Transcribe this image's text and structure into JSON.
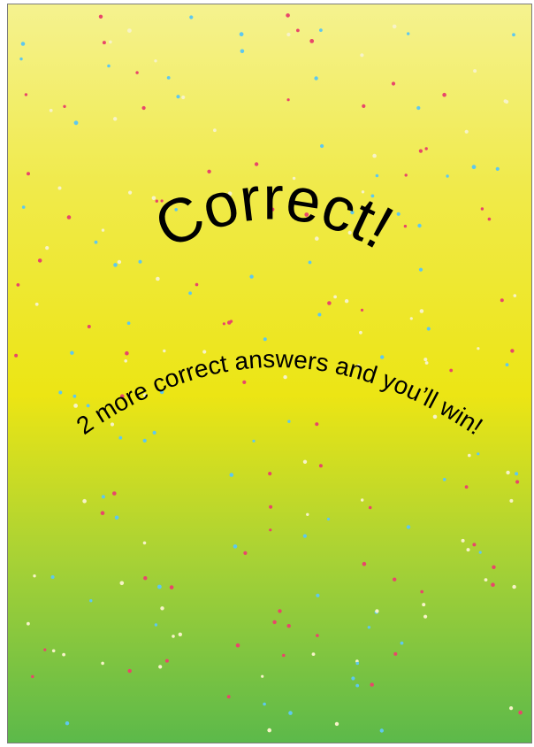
{
  "screen": {
    "title": "Correct!",
    "subtitle": "2 more correct answers and you’ll win!"
  },
  "colors": {
    "gradient_top": "#f5f28f",
    "gradient_middle": "#ece514",
    "gradient_bottom": "#5cb94a",
    "confetti": [
      "#e8466a",
      "#5ec8ee",
      "#f7f3c8"
    ]
  }
}
